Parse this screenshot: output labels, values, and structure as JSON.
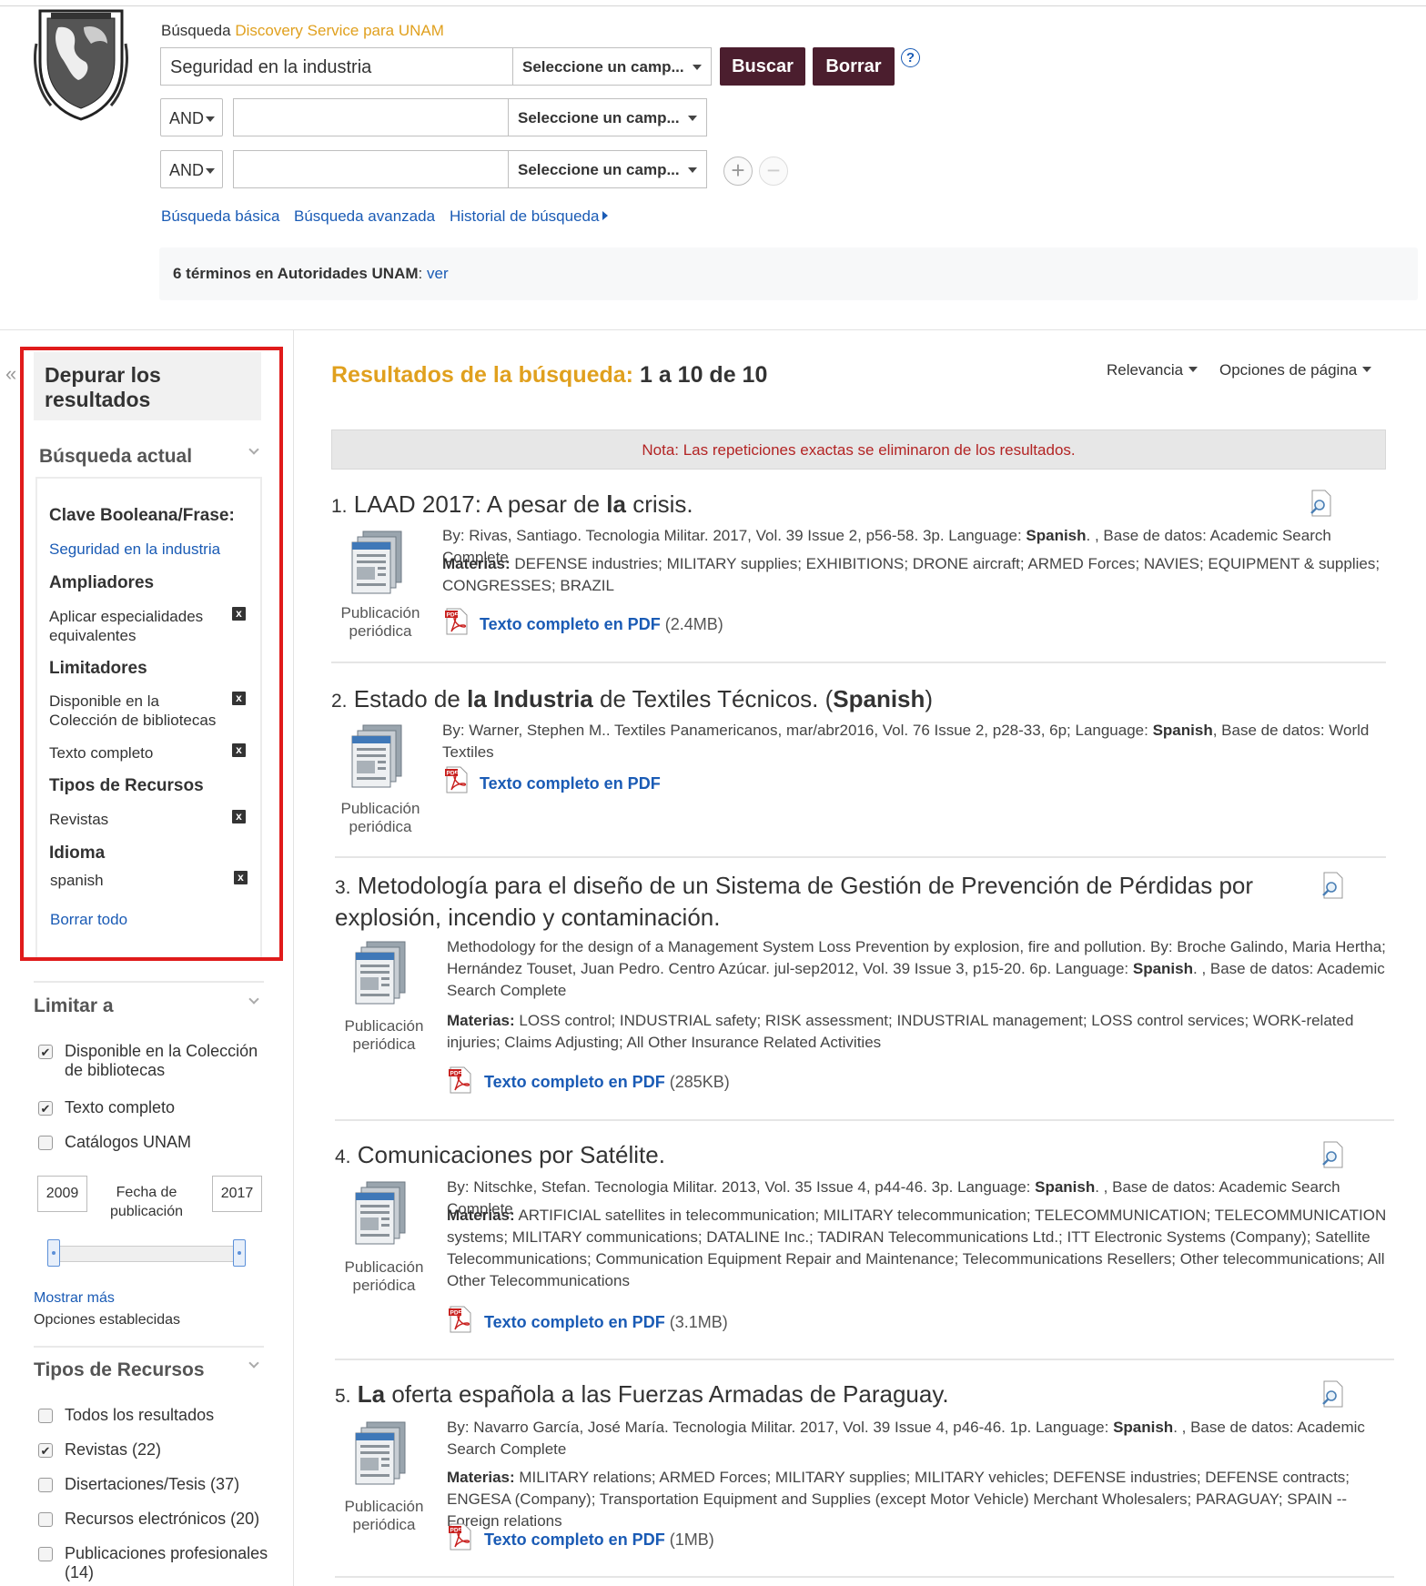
{
  "header": {
    "search_label": "Búsqueda",
    "service_name": "Discovery Service para UNAM",
    "query_value": "Seguridad en la industria",
    "field_select": "Seleccione un camp...",
    "search_button": "Buscar",
    "clear_button": "Borrar",
    "help": "?",
    "bool_operator": "AND",
    "add": "+",
    "remove": "−",
    "links": {
      "basic": "Búsqueda básica",
      "advanced": "Búsqueda avanzada",
      "history": "Historial de búsqueda"
    },
    "authority_text": "6 términos en Autoridades UNAM",
    "authority_sep": ":",
    "authority_link": "ver"
  },
  "sidebar": {
    "collapse": "«",
    "title": "Depurar los resultados",
    "current_search": {
      "heading": "Búsqueda actual",
      "boolean_label": "Clave Booleana/Frase:",
      "boolean_value": "Seguridad en la industria",
      "expanders_label": "Ampliadores",
      "expander_item": "Aplicar especialidades equivalentes",
      "limiters_label": "Limitadores",
      "limiter_items": [
        "Disponible en la Colección de bibliotecas",
        "Texto completo"
      ],
      "source_types_label": "Tipos de Recursos",
      "source_type_item": "Revistas",
      "language_label": "Idioma",
      "language_item": "spanish",
      "remove_mark": "x",
      "clear_all": "Borrar todo"
    },
    "limit_to": {
      "heading": "Limitar a",
      "options": [
        {
          "label": "Disponible en la Colección de bibliotecas",
          "checked": true
        },
        {
          "label": "Texto completo",
          "checked": true
        },
        {
          "label": "Catálogos UNAM",
          "checked": false
        }
      ],
      "date_from": "2009",
      "date_label": "Fecha de publicación",
      "date_to": "2017",
      "show_more": "Mostrar más",
      "set_options": "Opciones establecidas",
      "check_mark": "✔"
    },
    "source_types": {
      "heading": "Tipos de Recursos",
      "options": [
        {
          "label": "Todos los resultados",
          "checked": false
        },
        {
          "label": "Revistas (22)",
          "checked": true
        },
        {
          "label": "Disertaciones/Tesis (37)",
          "checked": false
        },
        {
          "label": "Recursos electrónicos (20)",
          "checked": false
        },
        {
          "label": "Publicaciones profesionales (14)",
          "checked": false
        }
      ]
    }
  },
  "results": {
    "heading_label": "Resultados de la búsqueda:",
    "heading_range": "1 a 10 de 10",
    "sort": "Relevancia",
    "page_options": "Opciones de página",
    "note": "Nota: Las repeticiones exactas se eliminaron de los resultados.",
    "pub_type": "Publicación periódica",
    "subjects_label": "Materias:",
    "pdf_label": "Texto completo en PDF",
    "items": [
      {
        "num": "1.",
        "title_a": "LAAD 2017: A pesar de ",
        "title_b": "la",
        "title_c": " crisis.",
        "meta_a": "By: Rivas, Santiago. Tecnologia Militar. 2017, Vol. 39 Issue 2, p56-58. 3p. Language: ",
        "meta_lang": "Spanish",
        "meta_b": ". , Base de datos: Academic Search Complete",
        "subjects": "DEFENSE industries; MILITARY supplies; EXHIBITIONS; DRONE aircraft; ARMED Forces; NAVIES; EQUIPMENT & supplies; CONGRESSES; BRAZIL",
        "pdf_size": "(2.4MB)"
      },
      {
        "num": "2.",
        "title_a": "Estado de ",
        "title_b": "la Industria",
        "title_c": " de Textiles Técnicos. (",
        "title_d": "Spanish",
        "title_e": ")",
        "meta_a": "By: Warner, Stephen M.. Textiles Panamericanos, mar/abr2016, Vol. 76 Issue 2, p28-33, 6p; Language: ",
        "meta_lang": "Spanish",
        "meta_b": ", Base de datos: World Textiles"
      },
      {
        "num": "3.",
        "title": "Metodología para el diseño de un Sistema de Gestión de Prevención de Pérdidas por explosión, incendio y contaminación.",
        "meta_a": "Methodology for the design of a Management System Loss Prevention by explosion, fire and pollution. By: Broche Galindo, Maria Hertha; Hernández Touset, Juan Pedro. Centro Azúcar. jul-sep2012, Vol. 39 Issue 3, p15-20. 6p. Language: ",
        "meta_lang": "Spanish",
        "meta_b": ". , Base de datos: Academic Search Complete",
        "subjects": "LOSS control; INDUSTRIAL safety; RISK assessment; INDUSTRIAL management; LOSS control services; WORK-related injuries; Claims Adjusting; All Other Insurance Related Activities",
        "pdf_size": "(285KB)"
      },
      {
        "num": "4.",
        "title": "Comunicaciones por Satélite.",
        "meta_a": "By: Nitschke, Stefan. Tecnologia Militar. 2013, Vol. 35 Issue 4, p44-46. 3p. Language: ",
        "meta_lang": "Spanish",
        "meta_b": ". , Base de datos: Academic Search Complete",
        "subjects": "ARTIFICIAL satellites in telecommunication; MILITARY telecommunication; TELECOMMUNICATION; TELECOMMUNICATION systems; MILITARY communications; DATALINE Inc.; TADIRAN Telecommunications Ltd.; ITT Electronic Systems (Company); Satellite Telecommunications; Communication Equipment Repair and Maintenance; Telecommunications Resellers; Other telecommunications; All Other Telecommunications",
        "pdf_size": "(3.1MB)"
      },
      {
        "num": "5.",
        "title_b": "La",
        "title_c": " oferta española a las Fuerzas Armadas de Paraguay.",
        "meta_a": "By: Navarro García, José María. Tecnologia Militar. 2017, Vol. 39 Issue 4, p46-46. 1p. Language: ",
        "meta_lang": "Spanish",
        "meta_b": ". , Base de datos: Academic Search Complete",
        "subjects": "MILITARY relations; ARMED Forces; MILITARY supplies; MILITARY vehicles; DEFENSE industries; DEFENSE contracts; ENGESA (Company); Transportation Equipment and Supplies (except Motor Vehicle) Merchant Wholesalers; PARAGUAY; SPAIN -- Foreign relations",
        "pdf_size": "(1MB)"
      }
    ]
  },
  "colors": {
    "accent": "#e0a01e",
    "button": "#4b1e2e",
    "link": "#1a5bb5",
    "highlight": "#e01b1b",
    "note_text": "#b32424"
  }
}
